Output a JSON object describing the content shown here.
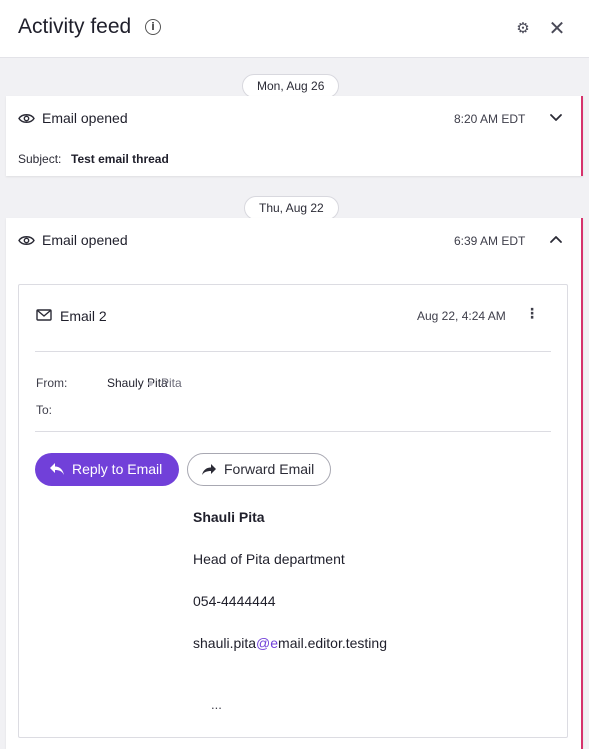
{
  "header": {
    "title": "Activity feed",
    "info_icon": "info-icon",
    "settings_icon": "gear-icon",
    "close_icon": "close-icon"
  },
  "feed": {
    "groups": [
      {
        "date": "Mon, Aug 26",
        "event": {
          "icon": "eye-icon",
          "label": "Email opened",
          "time": "8:20 AM EDT",
          "expanded": false,
          "subject_label": "Subject:",
          "subject_value": "Test email thread"
        }
      },
      {
        "date": "Thu, Aug 22",
        "event": {
          "icon": "eye-icon",
          "label": "Email opened",
          "time": "6:39 AM EDT",
          "expanded": true,
          "email": {
            "icon": "envelope-icon",
            "subject": "Email 2",
            "date": "Aug 22, 4:24 AM",
            "from_label": "From:",
            "from_name": "Shauly Pita",
            "from_org": "Pita",
            "to_label": "To:",
            "reply_label": "Reply to Email",
            "forward_label": "Forward Email",
            "signature": {
              "name": "Shauli Pita",
              "title": "Head of Pita department",
              "phone": "054-4444444",
              "email_prefix": "shauli.pita",
              "email_highlight": "@e",
              "email_suffix": "mail.editor.testing"
            },
            "more": "..."
          }
        }
      }
    ]
  },
  "colors": {
    "accent": "#7140d9",
    "card_edge": "#d6336c",
    "background": "#f1f1f4"
  }
}
